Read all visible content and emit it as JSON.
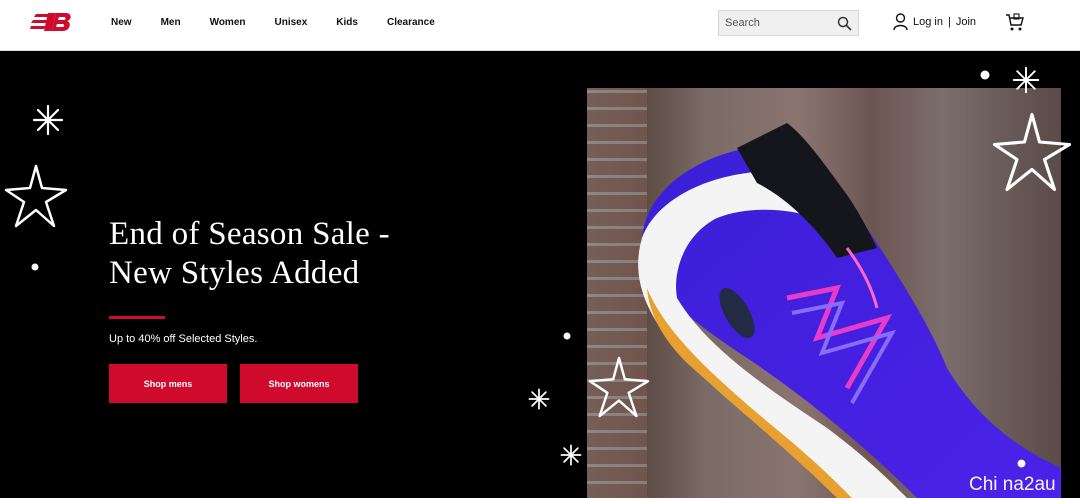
{
  "header": {
    "nav": [
      "New",
      "Men",
      "Women",
      "Unisex",
      "Kids",
      "Clearance"
    ],
    "search_placeholder": "Search",
    "login_label": "Log in",
    "separator": "|",
    "join_label": "Join"
  },
  "hero": {
    "title_line1": "End of Season Sale -",
    "title_line2": "New Styles Added",
    "subtitle": "Up to 40% off Selected Styles.",
    "btn_men": "Shop mens",
    "btn_women": "Shop womens"
  },
  "watermark": "Chi na2au",
  "colors": {
    "brand_red": "#cf0a2c",
    "hero_bg": "#000000"
  }
}
